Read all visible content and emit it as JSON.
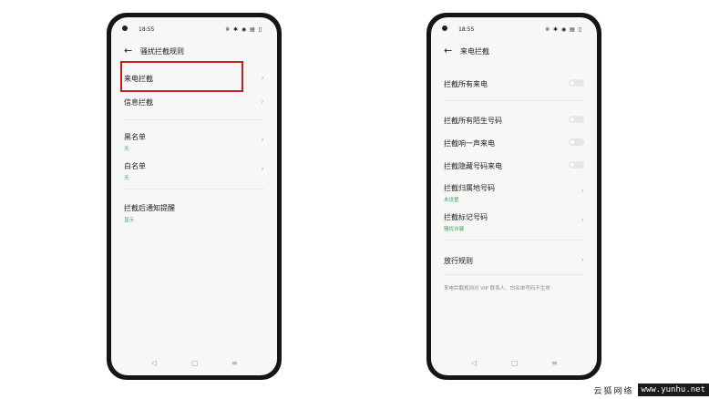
{
  "left_phone": {
    "status": {
      "time": "18:55",
      "icons": "※ ✱ ◉ ▤ ▯"
    },
    "title": "骚扰拦截规则",
    "items": [
      {
        "label": "来电拦截",
        "sub": ""
      },
      {
        "label": "信息拦截",
        "sub": ""
      },
      {
        "label": "黑名单",
        "sub": "无"
      },
      {
        "label": "白名单",
        "sub": "无"
      },
      {
        "label": "拦截后通知提醒",
        "sub": "显示"
      }
    ]
  },
  "right_phone": {
    "status": {
      "time": "18:55",
      "icons": "※ ✱ ◉ ▤ ▯"
    },
    "title": "来电拦截",
    "items": [
      {
        "label": "拦截所有来电",
        "sub": ""
      },
      {
        "label": "拦截所有陌生号码",
        "sub": ""
      },
      {
        "label": "拦截响一声来电",
        "sub": ""
      },
      {
        "label": "拦截隐藏号码来电",
        "sub": ""
      },
      {
        "label": "拦截归属地号码",
        "sub": "未设置"
      },
      {
        "label": "拦截标记号码",
        "sub": "骚扰诈骗"
      },
      {
        "label": "放行规则",
        "sub": ""
      }
    ],
    "note": "来电拦截规则对 VIP 联系人、白名单号码不生效"
  },
  "icons": {
    "back": "←",
    "chevron": "›",
    "nav_back": "◁",
    "nav_home": "▢",
    "nav_menu": "≡"
  },
  "watermark": {
    "cn": "云狐网络",
    "url": "www.yunhu.net"
  },
  "colors": {
    "highlight": "#c81e1e",
    "accent_green": "#3aa757"
  }
}
